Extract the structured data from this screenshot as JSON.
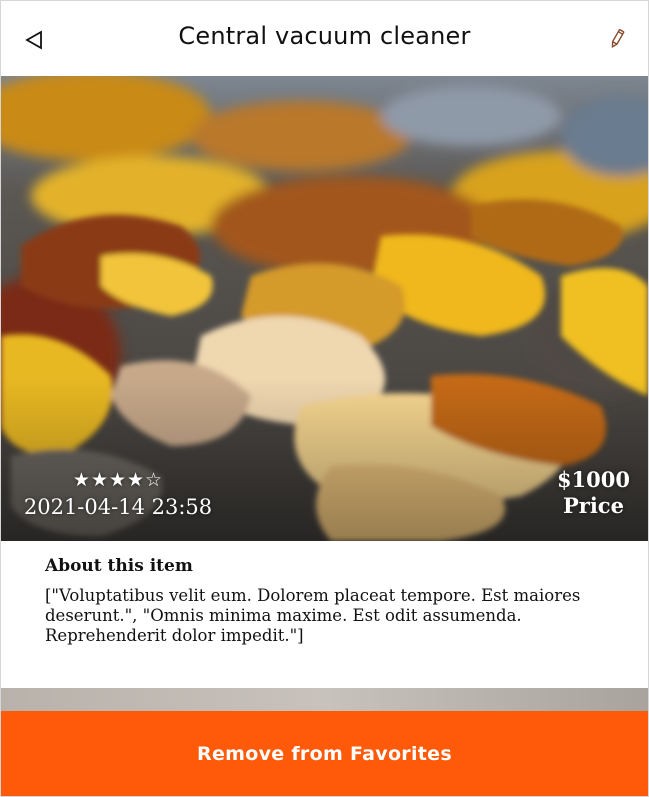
{
  "header": {
    "title": "Central vacuum cleaner",
    "back_icon": "back-arrow-icon",
    "edit_icon": "pencil-icon"
  },
  "item": {
    "rating": 4,
    "rating_max": 5,
    "rating_text": "★★★★☆",
    "datetime": "2021-04-14 23:58",
    "price": "$1000",
    "price_label": "Price"
  },
  "about": {
    "heading": "About this item",
    "body": "[\"Voluptatibus velit eum. Dolorem placeat tempore. Est maiores deserunt.\", \"Omnis minima maxime. Est odit assumenda. Reprehenderit dolor impedit.\"]"
  },
  "actions": {
    "remove_favorites_label": "Remove from Favorites"
  },
  "colors": {
    "accent": "#ff5a0a",
    "text": "#111111",
    "background": "#ffffff"
  }
}
